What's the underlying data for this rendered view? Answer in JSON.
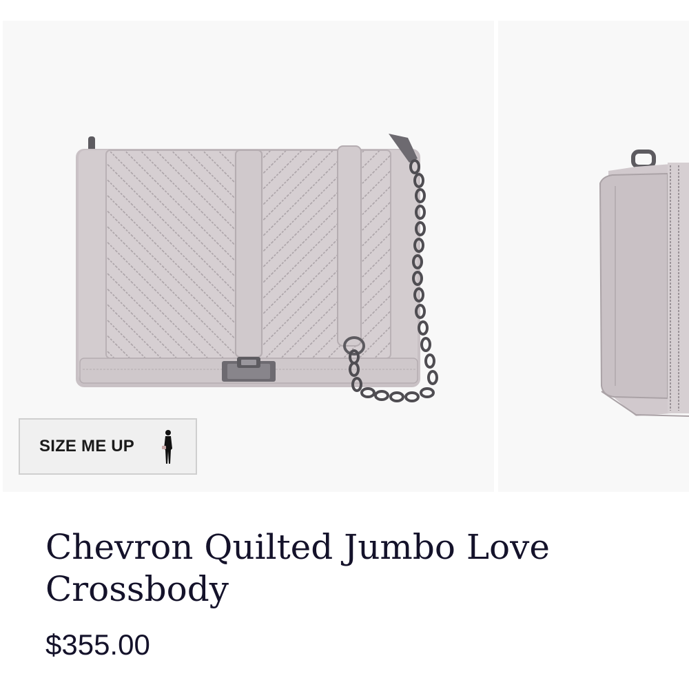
{
  "product": {
    "title": "Chevron Quilted Jumbo Love Crossbody",
    "price": "$355.00"
  },
  "gallery": {
    "main_image": "chevron-quilted-bag-front",
    "next_image": "chevron-quilted-bag-side",
    "size_button_label": "SIZE ME UP",
    "size_button_icon": "person-silhouette-icon"
  },
  "colors": {
    "background": "#ffffff",
    "photo_background": "#f8f8f8",
    "bag_leather": "#cec7ca",
    "hardware": "#5d5b60",
    "text": "#14122a"
  }
}
